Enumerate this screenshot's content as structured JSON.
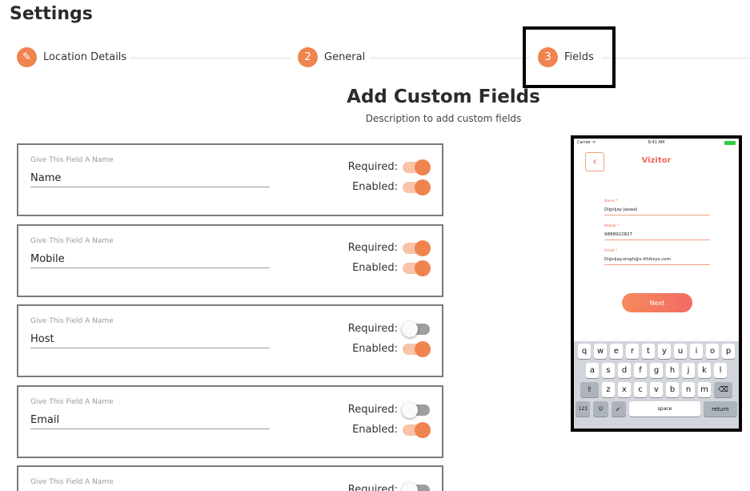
{
  "page": {
    "title": "Settings"
  },
  "stepper": {
    "steps": [
      {
        "badge": "✎",
        "label": "Location Details"
      },
      {
        "badge": "2",
        "label": "General"
      },
      {
        "badge": "3",
        "label": "Fields"
      }
    ],
    "active_index": 2
  },
  "section": {
    "title": "Add Custom Fields",
    "description": "Description to add custom fields"
  },
  "field_caption": "Give This Field A Name",
  "required_label": "Required:",
  "enabled_label": "Enabled:",
  "fields": [
    {
      "name": "Name",
      "required": true,
      "enabled": true
    },
    {
      "name": "Mobile",
      "required": true,
      "enabled": true
    },
    {
      "name": "Host",
      "required": false,
      "enabled": true
    },
    {
      "name": "Email",
      "required": false,
      "enabled": true
    },
    {
      "name": "",
      "required": false,
      "enabled": null
    }
  ],
  "colors": {
    "accent": "#f0844f",
    "toggle_track_on": "#f8c3a6",
    "toggle_track_off": "#9e9e9e",
    "brand_red": "#f06a5a"
  },
  "phone_preview": {
    "carrier": "Carrier ᯤ",
    "time": "8:41 AM",
    "back_icon": "chevron-left-icon",
    "app_title": "Vizitor",
    "fields": [
      {
        "label": "Name *",
        "value": "Digvijay Jaswal"
      },
      {
        "label": "Mobile *",
        "value": "9888922827"
      },
      {
        "label": "Email *",
        "value": "Digvijay.singh@v-ithiksys.com"
      }
    ],
    "next_label": "Next",
    "keyboard": {
      "row1": [
        "q",
        "w",
        "e",
        "r",
        "t",
        "y",
        "u",
        "i",
        "o",
        "p"
      ],
      "row2": [
        "a",
        "s",
        "d",
        "f",
        "g",
        "h",
        "j",
        "k",
        "l"
      ],
      "row3": [
        "z",
        "x",
        "c",
        "v",
        "b",
        "n",
        "m"
      ],
      "shift_icon": "⇧",
      "delete_icon": "⌫",
      "numbers_label": "123",
      "emoji_icon": "☺",
      "mic_icon": "🎤",
      "space_label": "space",
      "return_label": "return"
    }
  }
}
